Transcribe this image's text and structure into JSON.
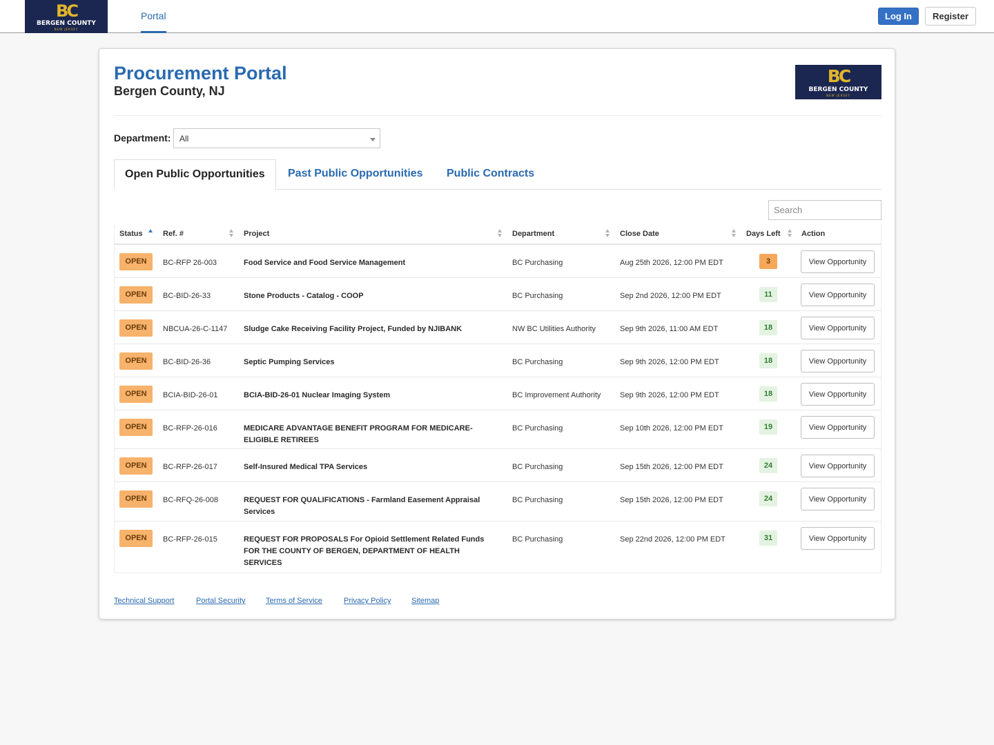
{
  "brand": {
    "monogram": "BC",
    "name": "BERGEN COUNTY",
    "sub": "NEW JERSEY",
    "colors": {
      "navy": "#1b2750",
      "gold": "#e2b52b"
    }
  },
  "nav": {
    "portal_tab": "Portal",
    "login_label": "Log In",
    "register_label": "Register"
  },
  "header": {
    "title": "Procurement Portal",
    "subtitle": "Bergen County, NJ"
  },
  "filters": {
    "department_label": "Department:",
    "department_value": "All"
  },
  "tabs": [
    {
      "label": "Open Public Opportunities",
      "active": true
    },
    {
      "label": "Past Public Opportunities",
      "active": false
    },
    {
      "label": "Public Contracts",
      "active": false
    }
  ],
  "search": {
    "placeholder": "Search"
  },
  "table": {
    "columns": [
      "Status",
      "Ref. #",
      "Project",
      "Department",
      "Close Date",
      "Days Left",
      "Action"
    ],
    "rows": [
      {
        "status": "OPEN",
        "ref": "BC-RFP 26-003",
        "project": "Food Service and Food Service Management",
        "department": "BC Purchasing",
        "close": "Aug 25th 2026, 12:00 PM EDT",
        "days": "3",
        "action": "View Opportunity"
      },
      {
        "status": "OPEN",
        "ref": "BC-BID-26-33",
        "project": "Stone Products - Catalog - COOP",
        "department": "BC Purchasing",
        "close": "Sep 2nd 2026, 12:00 PM EDT",
        "days": "11",
        "action": "View Opportunity"
      },
      {
        "status": "OPEN",
        "ref": "NBCUA-26-C-1147",
        "project": "Sludge Cake Receiving Facility Project, Funded by NJIBANK",
        "department": "NW BC Utilities Authority",
        "close": "Sep 9th 2026, 11:00 AM EDT",
        "days": "18",
        "action": "View Opportunity"
      },
      {
        "status": "OPEN",
        "ref": "BC-BID-26-36",
        "project": "Septic Pumping Services",
        "department": "BC Purchasing",
        "close": "Sep 9th 2026, 12:00 PM EDT",
        "days": "18",
        "action": "View Opportunity"
      },
      {
        "status": "OPEN",
        "ref": "BCIA-BID-26-01",
        "project": "BCIA-BID-26-01 Nuclear Imaging System",
        "department": "BC Improvement Authority",
        "close": "Sep 9th 2026, 12:00 PM EDT",
        "days": "18",
        "action": "View Opportunity"
      },
      {
        "status": "OPEN",
        "ref": "BC-RFP-26-016",
        "project": "MEDICARE ADVANTAGE BENEFIT PROGRAM FOR MEDICARE-ELIGIBLE RETIREES",
        "department": "BC Purchasing",
        "close": "Sep 10th 2026, 12:00 PM EDT",
        "days": "19",
        "action": "View Opportunity"
      },
      {
        "status": "OPEN",
        "ref": "BC-RFP-26-017",
        "project": "Self-Insured Medical TPA Services",
        "department": "BC Purchasing",
        "close": "Sep 15th 2026, 12:00 PM EDT",
        "days": "24",
        "action": "View Opportunity"
      },
      {
        "status": "OPEN",
        "ref": "BC-RFQ-26-008",
        "project": "REQUEST FOR QUALIFICATIONS - Farmland Easement Appraisal Services",
        "department": "BC Purchasing",
        "close": "Sep 15th 2026, 12:00 PM EDT",
        "days": "24",
        "action": "View Opportunity"
      },
      {
        "status": "OPEN",
        "ref": "BC-RFP-26-015",
        "project": "REQUEST FOR PROPOSALS For Opioid Settlement Related Funds FOR THE COUNTY OF BERGEN, DEPARTMENT OF HEALTH SERVICES",
        "department": "BC Purchasing",
        "close": "Sep 22nd 2026, 12:00 PM EDT",
        "days": "31",
        "action": "View Opportunity"
      }
    ]
  },
  "footer": {
    "links": [
      "Technical Support",
      "Portal Security",
      "Terms of Service",
      "Privacy Policy",
      "Sitemap"
    ]
  }
}
